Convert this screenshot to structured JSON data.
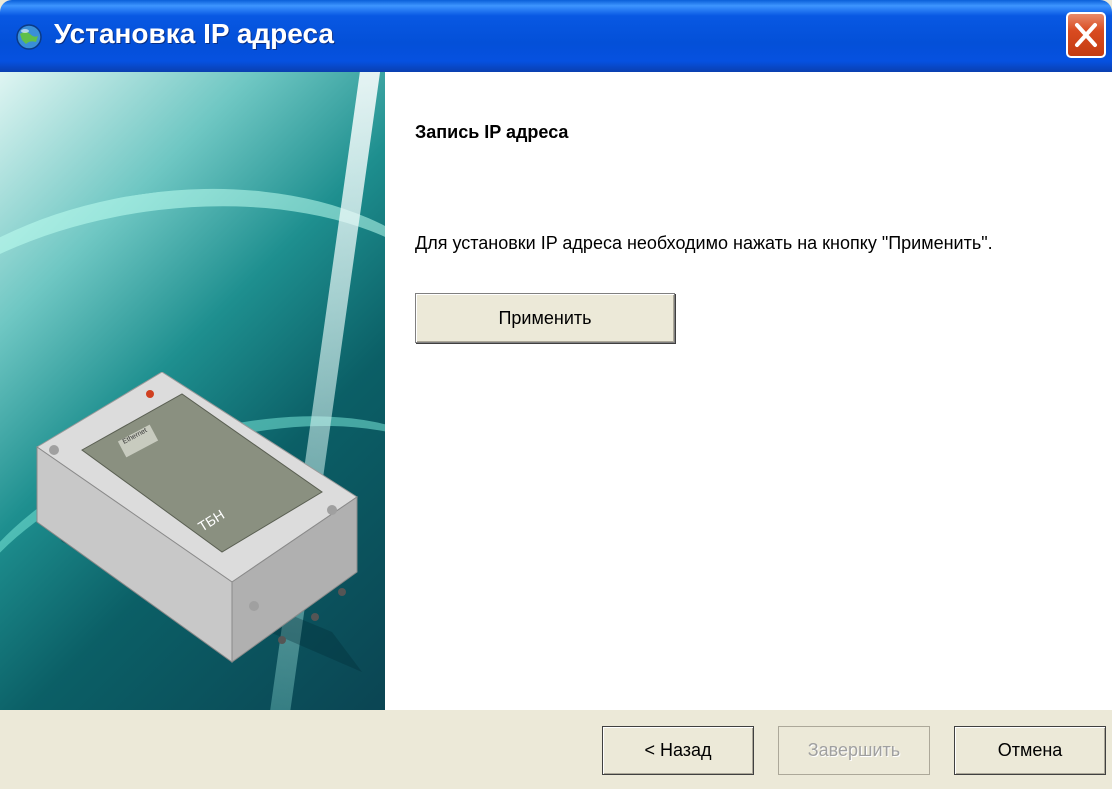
{
  "window": {
    "title": "Установка IP адреса",
    "icons": {
      "app": "globe-network-icon",
      "close": "close-icon"
    },
    "colors": {
      "titlebar": "#0450d8",
      "close": "#d94b20",
      "face": "#ece9d8"
    }
  },
  "page": {
    "title": "Запись IP адреса",
    "instruction": "Для установки IP адреса необходимо нажать на кнопку \"Применить\".",
    "apply_label": "Применить"
  },
  "banner": {
    "device_image": "device-photo",
    "device_labels": [
      "ТБН",
      "Ethernet"
    ]
  },
  "footer": {
    "back_label": "< Назад",
    "finish_label": "Завершить",
    "cancel_label": "Отмена",
    "finish_disabled": true
  }
}
